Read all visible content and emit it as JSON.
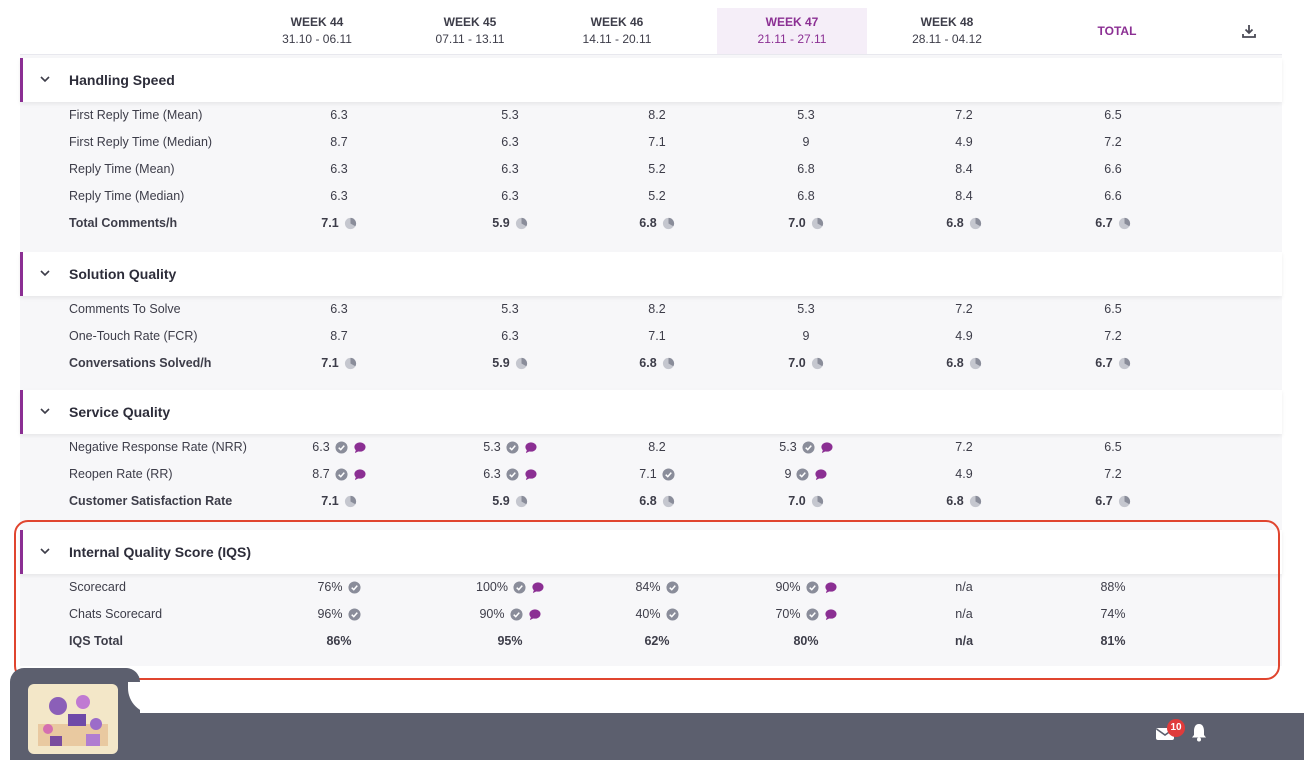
{
  "header": {
    "columns": [
      {
        "week": "WEEK 44",
        "range": "31.10 - 06.11"
      },
      {
        "week": "WEEK 45",
        "range": "07.11 - 13.11"
      },
      {
        "week": "WEEK 46",
        "range": "14.11 - 20.11"
      },
      {
        "week": "WEEK 47",
        "range": "21.11 - 27.11"
      },
      {
        "week": "WEEK 48",
        "range": "28.11 - 04.12"
      }
    ],
    "total_label": "TOTAL",
    "active_week_index": 3,
    "download_icon": "download-icon"
  },
  "sections": [
    {
      "title": "Handling Speed",
      "rows": [
        {
          "label": "First Reply Time (Mean)",
          "values": [
            "6.3",
            "5.3",
            "8.2",
            "5.3",
            "7.2",
            "6.5"
          ]
        },
        {
          "label": "First Reply Time (Median)",
          "values": [
            "8.7",
            "6.3",
            "7.1",
            "9",
            "4.9",
            "7.2"
          ]
        },
        {
          "label": "Reply Time (Mean)",
          "values": [
            "6.3",
            "6.3",
            "5.2",
            "6.8",
            "8.4",
            "6.6"
          ]
        },
        {
          "label": "Reply Time (Median)",
          "values": [
            "6.3",
            "6.3",
            "5.2",
            "6.8",
            "8.4",
            "6.6"
          ]
        },
        {
          "label": "Total Comments/h",
          "values": [
            "7.1",
            "5.9",
            "6.8",
            "7.0",
            "6.8",
            "6.7"
          ],
          "bold": true
        }
      ]
    },
    {
      "title": "Solution Quality",
      "rows": [
        {
          "label": "Comments To Solve",
          "values": [
            "6.3",
            "5.3",
            "8.2",
            "5.3",
            "7.2",
            "6.5"
          ]
        },
        {
          "label": "One-Touch Rate (FCR)",
          "values": [
            "8.7",
            "6.3",
            "7.1",
            "9",
            "4.9",
            "7.2"
          ]
        },
        {
          "label": "Conversations Solved/h",
          "values": [
            "7.1",
            "5.9",
            "6.8",
            "7.0",
            "6.8",
            "6.7"
          ],
          "bold": true
        }
      ]
    },
    {
      "title": "Service Quality",
      "rows": [
        {
          "label": "Negative Response Rate (NRR)",
          "values": [
            "6.3",
            "5.3",
            "8.2",
            "5.3",
            "7.2",
            "6.5"
          ]
        },
        {
          "label": "Reopen Rate (RR)",
          "values": [
            "8.7",
            "6.3",
            "7.1",
            "9",
            "4.9",
            "7.2"
          ]
        },
        {
          "label": "Customer Satisfaction Rate",
          "values": [
            "7.1",
            "5.9",
            "6.8",
            "7.0",
            "6.8",
            "6.7"
          ],
          "bold": true
        }
      ]
    },
    {
      "title": "Internal Quality Score (IQS)",
      "rows": [
        {
          "label": "Scorecard",
          "values": [
            "76%",
            "100%",
            "84%",
            "90%",
            "n/a",
            "88%"
          ]
        },
        {
          "label": "Chats Scorecard",
          "values": [
            "96%",
            "90%",
            "40%",
            "70%",
            "n/a",
            "74%"
          ]
        },
        {
          "label": "IQS Total",
          "values": [
            "86%",
            "95%",
            "62%",
            "80%",
            "n/a",
            "81%"
          ],
          "bold": true
        }
      ]
    }
  ],
  "footer": {
    "notification_count": "10",
    "mail_icon": "mail-icon",
    "bell_icon": "bell-icon"
  },
  "colors": {
    "accent": "#8b2f93",
    "highlight_border": "#e0452f",
    "footer_bg": "#5c5f6e",
    "badge": "#e03b3b"
  }
}
